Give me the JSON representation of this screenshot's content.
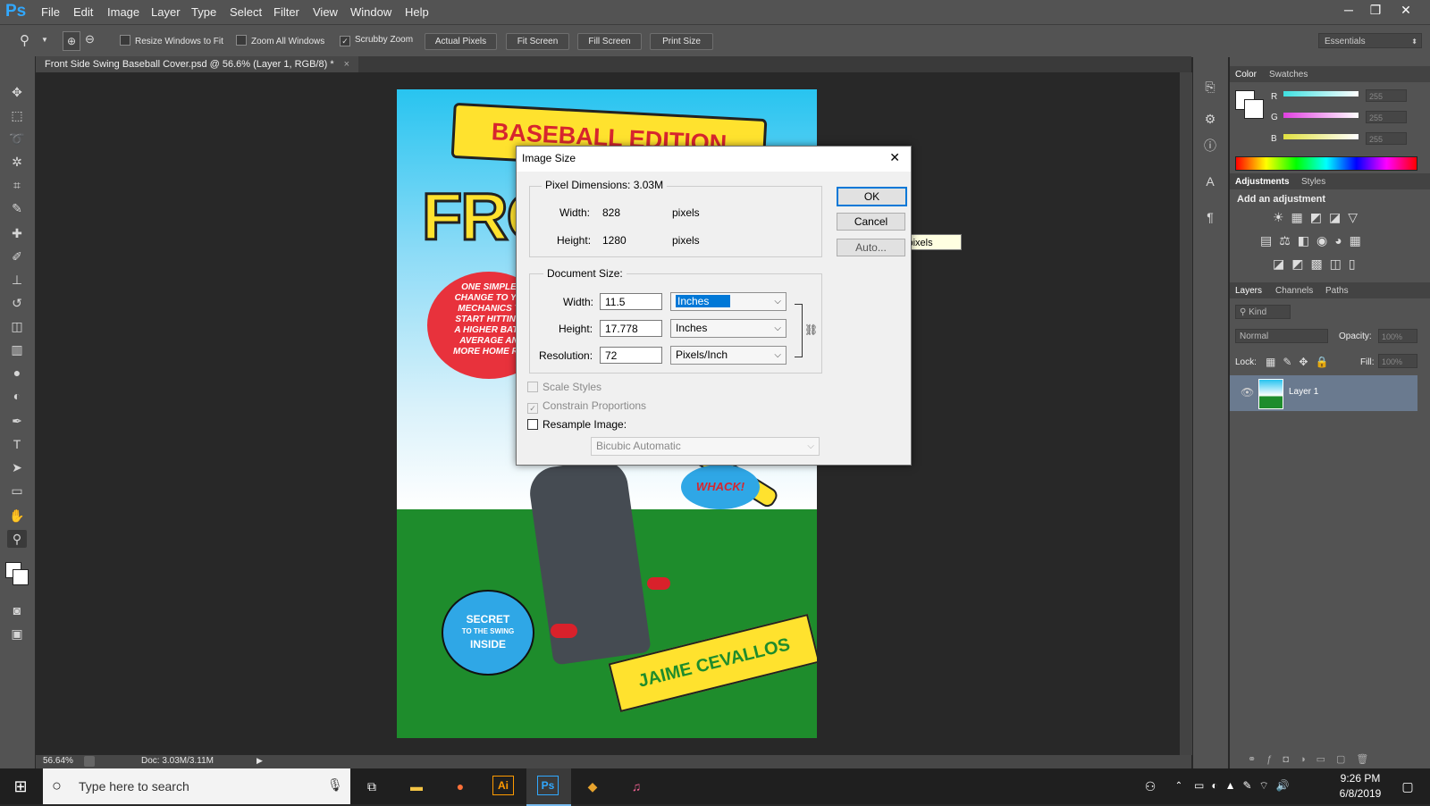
{
  "app": {
    "logo": "Ps",
    "menus": [
      "File",
      "Edit",
      "Image",
      "Layer",
      "Type",
      "Select",
      "Filter",
      "View",
      "Window",
      "Help"
    ],
    "window_controls": [
      "─",
      "❐",
      "✕"
    ]
  },
  "options_bar": {
    "resize_windows": "Resize Windows to Fit",
    "zoom_all": "Zoom All Windows",
    "scrubby_zoom": "Scrubby Zoom",
    "buttons": [
      "Actual Pixels",
      "Fit Screen",
      "Fill Screen",
      "Print Size"
    ],
    "workspace": "Essentials"
  },
  "document": {
    "tab_title": "Front Side Swing Baseball Cover.psd @ 56.6% (Layer 1, RGB/8) *",
    "tab_close": "×",
    "zoom": "56.64%",
    "doc_info": "Doc: 3.03M/3.11M"
  },
  "artwork": {
    "banner": "BASEBALL EDITION",
    "title_fragment": "FRON",
    "bubble_lines": [
      "ONE SIMPLE",
      "CHANGE TO YO",
      "MECHANICS T",
      "START HITTING",
      "A HIGHER BATT",
      "AVERAGE AN",
      "MORE HOME RU"
    ],
    "whack": "WHACK!",
    "secret_lines": [
      "SECRET",
      "TO THE SWING",
      "INSIDE"
    ],
    "author": "JAIME CEVALLOS"
  },
  "panels": {
    "color_tabs": [
      "Color",
      "Swatches"
    ],
    "rgb": [
      {
        "label": "R",
        "value": "255",
        "color": "#3fe0e0"
      },
      {
        "label": "G",
        "value": "255",
        "color": "#e040e0"
      },
      {
        "label": "B",
        "value": "255",
        "color": "#e0e040"
      }
    ],
    "adj_tabs": [
      "Adjustments",
      "Styles"
    ],
    "add_adjustment": "Add an adjustment",
    "layers_tabs": [
      "Layers",
      "Channels",
      "Paths"
    ],
    "kind": "Kind",
    "blend_mode": "Normal",
    "opacity_label": "Opacity:",
    "opacity_value": "100%",
    "lock_label": "Lock:",
    "fill_label": "Fill:",
    "fill_value": "100%",
    "layer_name": "Layer 1"
  },
  "dialog": {
    "title": "Image Size",
    "close": "✕",
    "pixel_dimensions_label": "Pixel Dimensions:",
    "pixel_dimensions_value": "3.03M",
    "px_width_label": "Width:",
    "px_width_value": "828",
    "px_height_label": "Height:",
    "px_height_value": "1280",
    "px_unit": "pixels",
    "document_size_label": "Document Size:",
    "doc_width_label": "Width:",
    "doc_width_value": "11.5",
    "doc_width_unit": "Inches",
    "doc_height_label": "Height:",
    "doc_height_value": "17.778",
    "doc_height_unit": "Inches",
    "resolution_label": "Resolution:",
    "resolution_value": "72",
    "resolution_unit": "Pixels/Inch",
    "scale_styles": "Scale Styles",
    "constrain": "Constrain Proportions",
    "resample": "Resample Image:",
    "resample_method": "Bicubic Automatic",
    "ok": "OK",
    "cancel": "Cancel",
    "auto": "Auto..."
  },
  "tooltip": "Describes the size of the document in pixels",
  "taskbar": {
    "search_placeholder": "Type here to search",
    "time": "9:26 PM",
    "date": "6/8/2019"
  }
}
